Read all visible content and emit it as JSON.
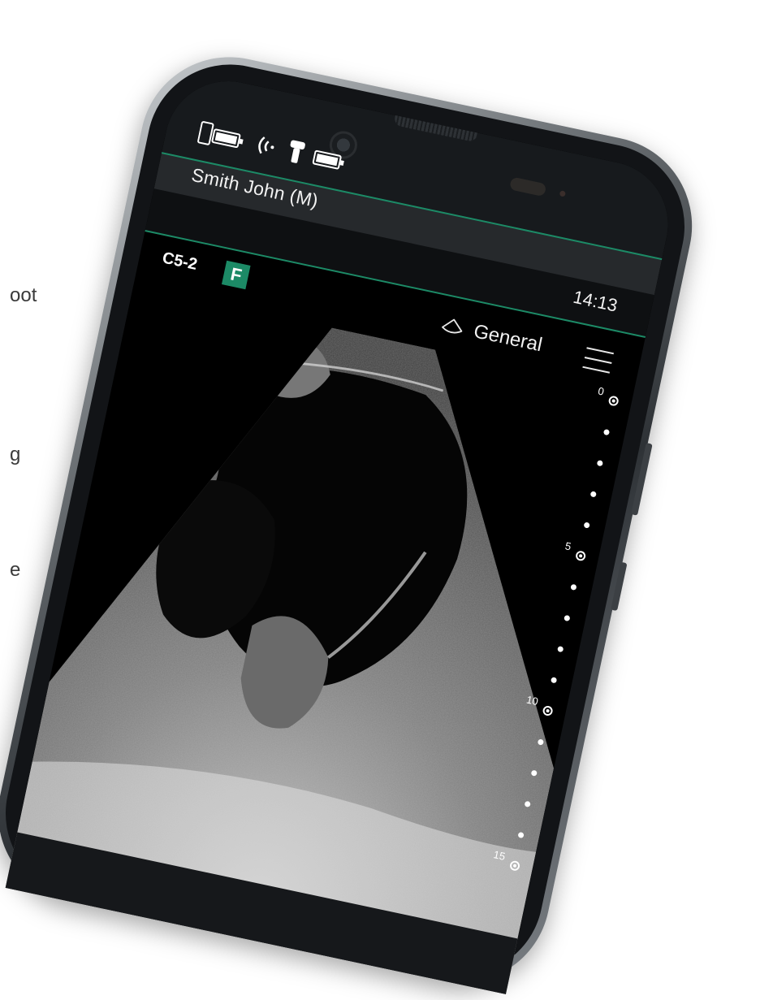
{
  "background_text": [
    "oot",
    "g",
    "e"
  ],
  "status_bar": {
    "icons": [
      "phone-battery-icon",
      "wireless-signal-icon",
      "probe-icon",
      "probe-battery-icon"
    ]
  },
  "patient": {
    "name": "Smith John (M)"
  },
  "clock": {
    "time": "14:13"
  },
  "probe": {
    "model": "C5-2",
    "frequency_badge": "F"
  },
  "preset": {
    "icon": "convex-probe-outline-icon",
    "label": "General"
  },
  "menu": {
    "icon": "hamburger-menu-icon"
  },
  "depth_scale": {
    "unit_ticks": [
      0,
      5,
      10,
      15
    ],
    "minor_dots_between": 4
  },
  "colors": {
    "accent": "#1c8a66",
    "screen_bg": "#000000",
    "bar_bg": "#26292c"
  }
}
